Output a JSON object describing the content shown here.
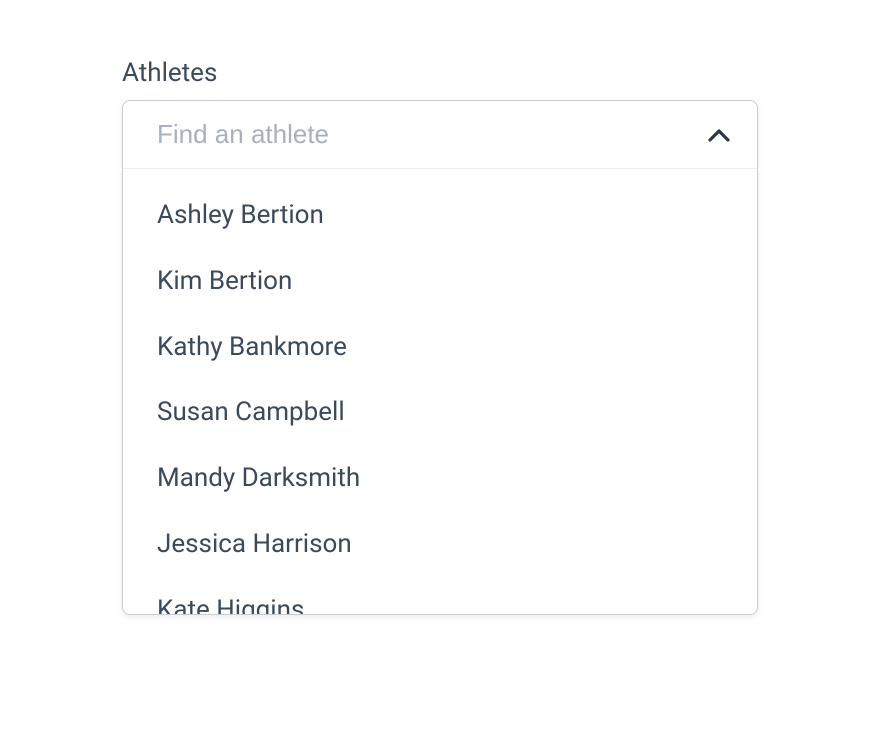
{
  "label": "Athletes",
  "search": {
    "placeholder": "Find an athlete",
    "value": ""
  },
  "options": [
    {
      "name": "Ashley Bertion"
    },
    {
      "name": "Kim Bertion"
    },
    {
      "name": "Kathy Bankmore"
    },
    {
      "name": "Susan Campbell"
    },
    {
      "name": "Mandy Darksmith"
    },
    {
      "name": "Jessica Harrison"
    },
    {
      "name": "Kate Higgins"
    }
  ]
}
